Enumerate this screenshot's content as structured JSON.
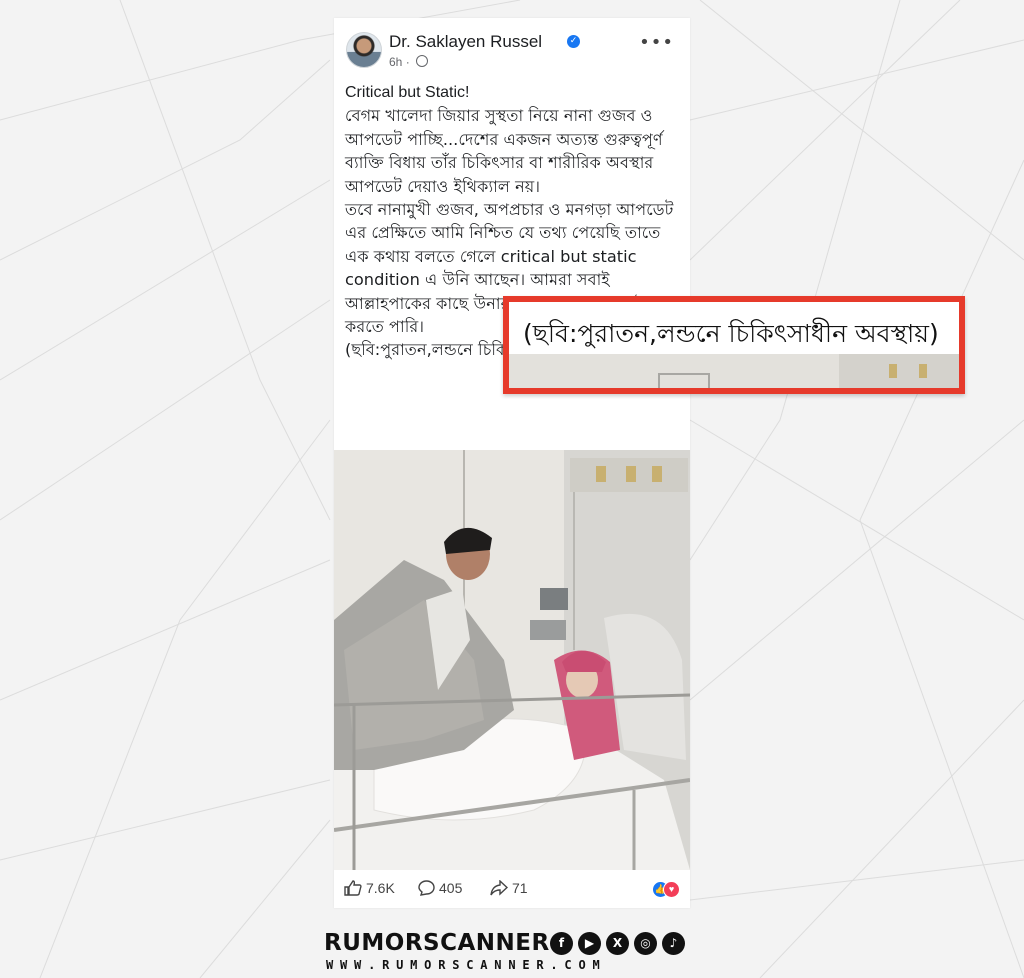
{
  "post": {
    "author": "Dr. Saklayen Russel",
    "verified_icon": "verified-badge-icon",
    "time": "6h",
    "privacy_icon": "globe-icon",
    "more_label": "•••",
    "title": "Critical but Static!",
    "body": "বেগম খালেদা জিয়ার সুস্থতা নিয়ে নানা গুজব ও আপডেট পাচ্ছি...দেশের একজন অত্যন্ত গুরুত্বপূর্ণ ব্যাক্তি বিধায় তাঁর চিকিৎসার বা শারীরিক অবস্থার আপডেট দেয়াও ইথিক্যাল নয়।\nতবে নানামুখী গুজব, অপপ্রচার ও মনগড়া আপডেট এর প্রেক্ষিতে আমি নিশ্চিত যে তথ্য পেয়েছি তাতে এক কথায় বলতে গেলে critical but static condition এ উনি আছেন। আমরা সবাই আল্লাহপাকের কাছে উনার সুস্থতার জন্য দোয়াই করতে পারি।",
    "caption": "(ছবি:পুরাতন,লন্ডনে চিকিৎসাধীন অবস্থায়)",
    "likes": "7.6K",
    "comments": "405",
    "shares": "71",
    "reaction_icons": [
      "like-reaction-icon",
      "love-reaction-icon"
    ]
  },
  "callout": {
    "text": "(ছবি:পুরাতন,লন্ডনে চিকিৎসাধীন অবস্থায়)",
    "border_color": "#e63a2b"
  },
  "brand": {
    "name": "RUMORSCANNER",
    "url": "WWW.RUMORSCANNER.COM",
    "social_icons": [
      "facebook-icon",
      "youtube-icon",
      "x-icon",
      "instagram-icon",
      "tiktok-icon"
    ]
  },
  "colors": {
    "accent": "#1877f2",
    "like": "#1877f2",
    "love": "#f33e58"
  }
}
